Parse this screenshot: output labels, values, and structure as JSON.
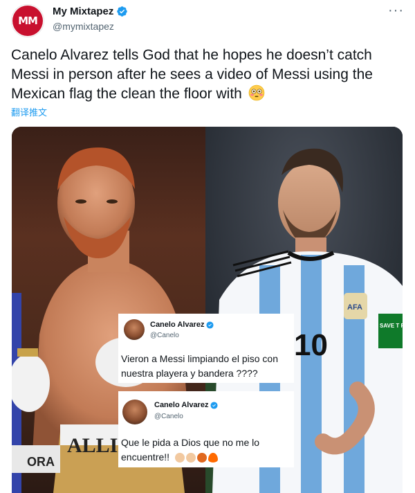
{
  "author": {
    "display_name": "My Mixtapez",
    "handle": "@mymixtapez",
    "avatar_text": "MM",
    "verified_icon": "verified-badge-icon",
    "more_label": "···"
  },
  "tweet": {
    "text": "Canelo Alvarez tells God that he hopes he doesn’t catch Messi in person after he sees a video of Messi using the Mexican flag the clean the floor with",
    "emoji": "flushed-face-icon",
    "translate_label": "翻译推文"
  },
  "media": {
    "left_photo_caption_fragment": "ALLIE",
    "left_photo_corner": "ORA",
    "right_photo_number": "10",
    "right_photo_patch": "AFA",
    "right_photo_sleeve": "SAVE T PLON"
  },
  "embedded_tweets": [
    {
      "display_name": "Canelo Alvarez",
      "handle": "@Canelo",
      "text_line_1": "Vieron a Messi limpiando el piso con",
      "text_line_2": "nuestra playera y bandera ????"
    },
    {
      "display_name": "Canelo Alvarez",
      "handle": "@Canelo",
      "text_line_1": "Que le pida a Dios que no me lo",
      "text_line_2": "encuentre!!",
      "emojis": [
        "fist-icon",
        "fist-icon",
        "angry-face-icon",
        "fire-icon"
      ]
    }
  ],
  "colors": {
    "brand_red": "#c8102e",
    "verified_blue": "#1d9bf0",
    "text_primary": "#0f1419",
    "text_secondary": "#536471"
  }
}
